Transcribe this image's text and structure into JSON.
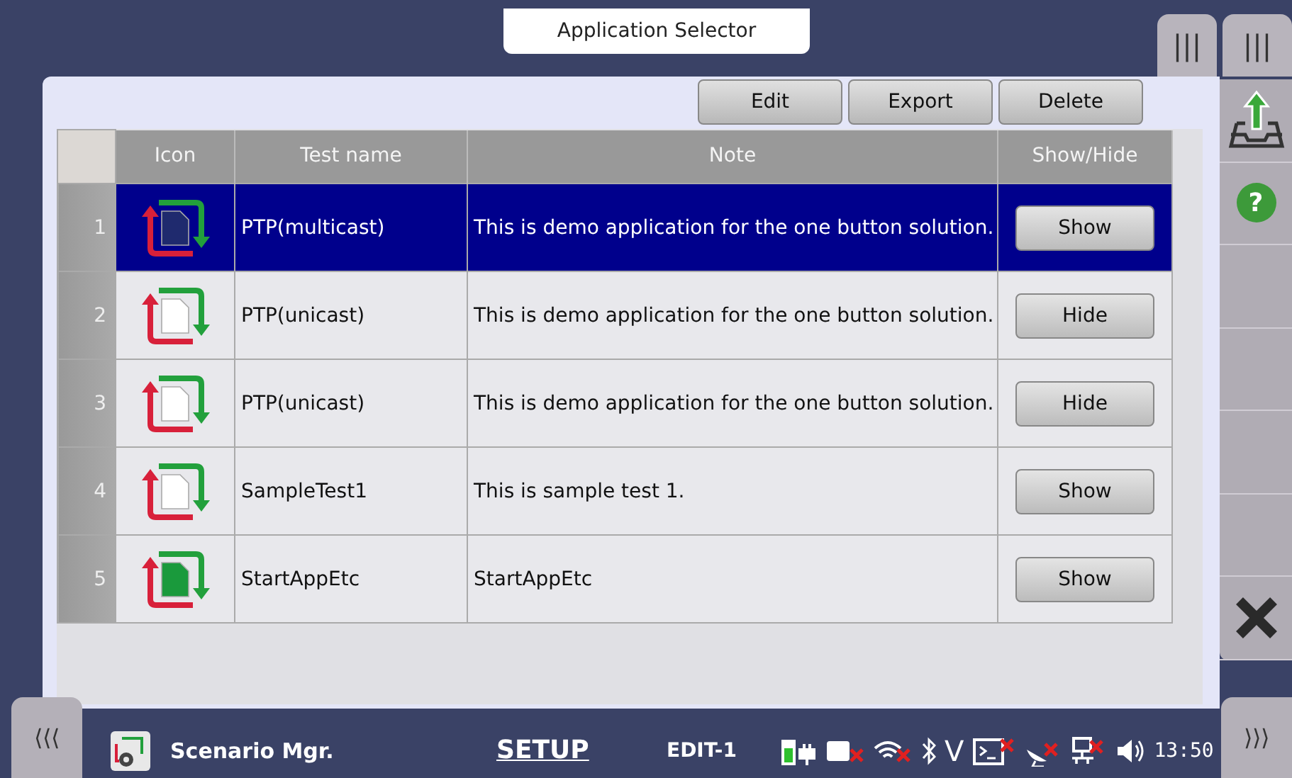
{
  "window": {
    "title": "Application Selector"
  },
  "toolbar": {
    "buttons": [
      "Edit",
      "Export",
      "Delete"
    ]
  },
  "table": {
    "columns": [
      "Icon",
      "Test name",
      "Note",
      "Show/Hide"
    ],
    "rows": [
      {
        "number": "1",
        "selected": true,
        "icon": {
          "color": "#1f2a6e"
        },
        "name": "PTP(multicast)",
        "note": "This is demo application for the one button solution.",
        "action": "Show"
      },
      {
        "number": "2",
        "selected": false,
        "icon": {
          "color": "#ffffff"
        },
        "name": "PTP(unicast)",
        "note": "This is demo application for the one button solution.",
        "action": "Hide"
      },
      {
        "number": "3",
        "selected": false,
        "icon": {
          "color": "#ffffff"
        },
        "name": "PTP(unicast)",
        "note": "This is demo application for the one button solution.",
        "action": "Hide"
      },
      {
        "number": "4",
        "selected": false,
        "icon": {
          "color": "#ffffff"
        },
        "name": "SampleTest1",
        "note": "This is sample test 1.",
        "action": "Show"
      },
      {
        "number": "5",
        "selected": false,
        "icon": {
          "color": "#1a9a3c"
        },
        "name": "StartAppEtc",
        "note": "StartAppEtc",
        "action": "Show"
      }
    ]
  },
  "side_tabs": [
    "|||",
    "|||"
  ],
  "sidebar": {
    "items": [
      {
        "kind": "export"
      },
      {
        "kind": "help",
        "label": "?"
      },
      {
        "kind": "empty"
      },
      {
        "kind": "empty"
      },
      {
        "kind": "empty"
      },
      {
        "kind": "empty"
      },
      {
        "kind": "close"
      }
    ]
  },
  "nav": {
    "left": "⟨⟨⟨",
    "right": "⟩⟩⟩"
  },
  "status_bar": {
    "app": "Scenario Mgr.",
    "mode": "SETUP",
    "screen": "EDIT-1",
    "v_label": "V",
    "time": "13:50"
  }
}
